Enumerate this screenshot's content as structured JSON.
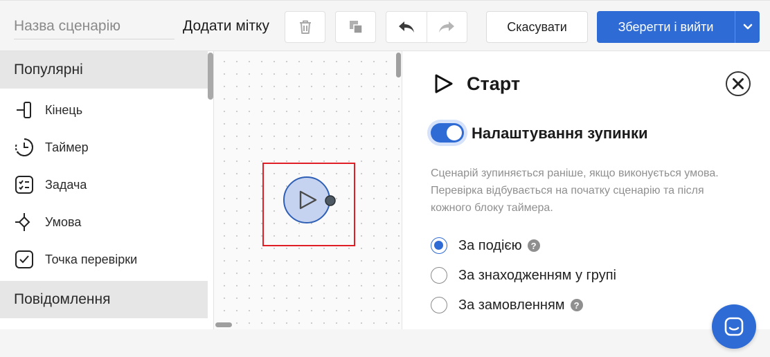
{
  "toolbar": {
    "name_placeholder": "Назва сценарію",
    "add_tag_label": "Додати мітку",
    "cancel_label": "Скасувати",
    "save_label": "Зберегти і вийти"
  },
  "palette": {
    "sections": [
      {
        "title": "Популярні",
        "items": [
          {
            "label": "Кінець",
            "icon": "end-icon"
          },
          {
            "label": "Таймер",
            "icon": "timer-icon"
          },
          {
            "label": "Задача",
            "icon": "task-icon"
          },
          {
            "label": "Умова",
            "icon": "condition-icon"
          },
          {
            "label": "Точка перевірки",
            "icon": "checkpoint-icon"
          }
        ]
      },
      {
        "title": "Повідомлення",
        "items": []
      }
    ]
  },
  "canvas": {
    "node": {
      "icon": "play-icon",
      "selected": true
    }
  },
  "panel": {
    "title": "Старт",
    "toggle_label": "Налаштування зупинки",
    "toggle_on": true,
    "description": "Сценарій зупиняється раніше, якщо виконується умова. Перевірка відбувається на початку сценарію та після кожного блоку таймера.",
    "options": [
      {
        "label": "За подією",
        "selected": true,
        "help": true
      },
      {
        "label": "За знаходженням у групі",
        "selected": false,
        "help": false
      },
      {
        "label": "За замовленням",
        "selected": false,
        "help": true
      }
    ],
    "help_glyph": "?"
  },
  "colors": {
    "accent": "#2f6bd4",
    "selection": "#e01e25",
    "node_fill": "#c5d3f0",
    "palette_header": "#e6e6e6"
  }
}
